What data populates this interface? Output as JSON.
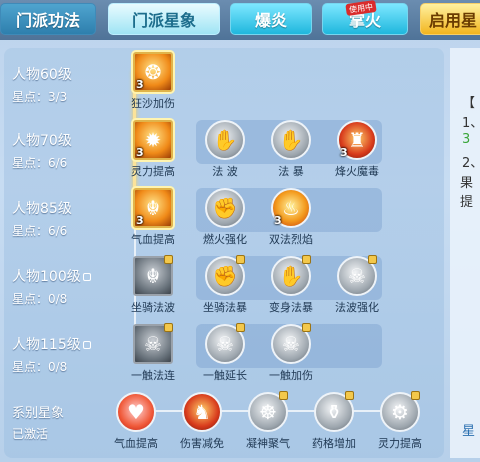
{
  "tabs": [
    "门派功法",
    "门派星象",
    "爆炎",
    "掌火",
    "启用星"
  ],
  "badge": "使用中",
  "rows": [
    {
      "title": "人物60级",
      "points": "星点：3/3",
      "locked": false
    },
    {
      "title": "人物70级",
      "points": "星点：6/6",
      "locked": false
    },
    {
      "title": "人物85级",
      "points": "星点：6/6",
      "locked": false
    },
    {
      "title": "人物100级",
      "points": "星点：0/8",
      "locked": true
    },
    {
      "title": "人物115级",
      "points": "星点：0/8",
      "locked": true
    }
  ],
  "series": {
    "title": "系别星象",
    "status": "已激活"
  },
  "nodes": {
    "r1": [
      {
        "name": "狂沙加伤",
        "level": "3",
        "icon": "flame-sand-icon"
      }
    ],
    "r2": [
      {
        "name": "灵力提高",
        "level": "3",
        "icon": "sun-burst-icon"
      },
      {
        "name": "法 波",
        "level": "",
        "icon": "wave-icon"
      },
      {
        "name": "法 暴",
        "level": "",
        "icon": "palm-icon"
      },
      {
        "name": "烽火魔毒",
        "level": "3",
        "icon": "tower-icon"
      }
    ],
    "r3": [
      {
        "name": "气血提高",
        "level": "3",
        "icon": "beast-icon"
      },
      {
        "name": "燃火强化",
        "level": "",
        "icon": "fist-icon"
      },
      {
        "name": "双法烈焰",
        "level": "3",
        "icon": "fire-icon"
      }
    ],
    "r4": [
      {
        "name": "坐骑法波",
        "level": "",
        "icon": "beast-icon"
      },
      {
        "name": "坐骑法暴",
        "level": "",
        "icon": "fist-icon"
      },
      {
        "name": "变身法暴",
        "level": "",
        "icon": "palm-icon"
      },
      {
        "name": "法波强化",
        "level": "",
        "icon": "demon-icon"
      }
    ],
    "r5": [
      {
        "name": "一触法连",
        "level": "",
        "icon": "demon-icon"
      },
      {
        "name": "一触延长",
        "level": "",
        "icon": "demon-icon"
      },
      {
        "name": "一触加伤",
        "level": "",
        "icon": "demon-icon"
      }
    ],
    "bottom": [
      {
        "name": "气血提高",
        "icon": "heart-icon"
      },
      {
        "name": "伤害减免",
        "icon": "warrior-icon"
      },
      {
        "name": "凝神聚气",
        "icon": "meditate-icon"
      },
      {
        "name": "药格增加",
        "icon": "gourd-icon"
      },
      {
        "name": "灵力提高",
        "icon": "gear-icon"
      }
    ]
  },
  "side": [
    "【",
    "1、",
    "3",
    "2、",
    "果提",
    "星"
  ],
  "colors": {
    "side_number": "#3aa63a"
  }
}
